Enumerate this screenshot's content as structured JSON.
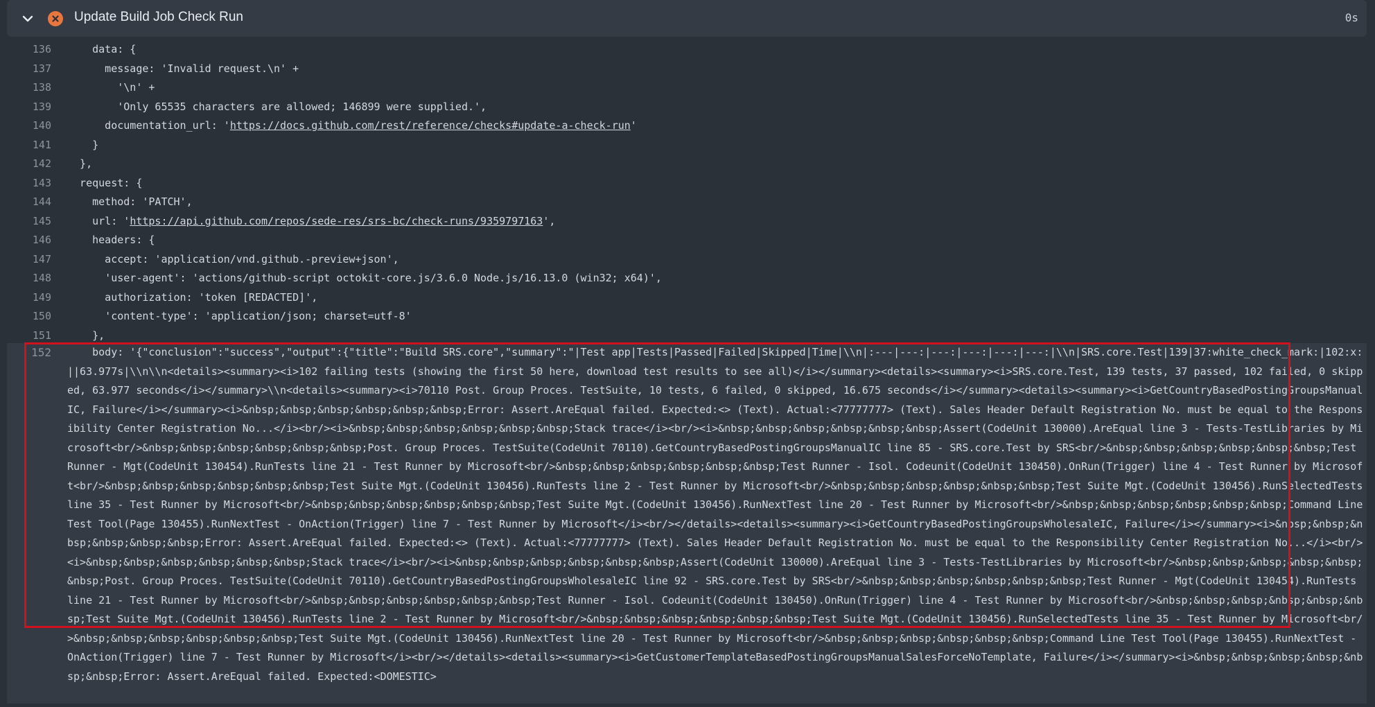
{
  "step": {
    "title": "Update Build Job Check Run",
    "duration": "0s"
  },
  "log_lines": [
    {
      "n": "136",
      "text": "    data: {"
    },
    {
      "n": "137",
      "text": "      message: 'Invalid request.\\n' +"
    },
    {
      "n": "138",
      "text": "        '\\n' +"
    },
    {
      "n": "139",
      "text": "        'Only 65535 characters are allowed; 146899 were supplied.',"
    },
    {
      "n": "140",
      "prefix": "      documentation_url: '",
      "link": "https://docs.github.com/rest/reference/checks#update-a-check-run",
      "suffix": "'"
    },
    {
      "n": "141",
      "text": "    }"
    },
    {
      "n": "142",
      "text": "  },"
    },
    {
      "n": "143",
      "text": "  request: {"
    },
    {
      "n": "144",
      "text": "    method: 'PATCH',"
    },
    {
      "n": "145",
      "prefix": "    url: '",
      "link": "https://api.github.com/repos/sede-res/srs-bc/check-runs/9359797163",
      "suffix": "',"
    },
    {
      "n": "146",
      "text": "    headers: {"
    },
    {
      "n": "147",
      "text": "      accept: 'application/vnd.github.-preview+json',"
    },
    {
      "n": "148",
      "text": "      'user-agent': 'actions/github-script octokit-core.js/3.6.0 Node.js/16.13.0 (win32; x64)',"
    },
    {
      "n": "149",
      "text": "      authorization: 'token [REDACTED]',"
    },
    {
      "n": "150",
      "text": "      'content-type': 'application/json; charset=utf-8'"
    },
    {
      "n": "151",
      "text": "    },"
    }
  ],
  "body_line": {
    "n": "152",
    "text": "    body: '{\"conclusion\":\"success\",\"output\":{\"title\":\"Build SRS.core\",\"summary\":\"|Test app|Tests|Passed|Failed|Skipped|Time|\\\\n|:---|---:|---:|---:|---:|---:|\\\\n|SRS.core.Test|139|37:white_check_mark:|102:x:||63.977s|\\\\n\\\\n<details><summary><i>102 failing tests (showing the first 50 here, download test results to see all)</i></summary><details><summary><i>SRS.core.Test, 139 tests, 37 passed, 102 failed, 0 skipped, 63.977 seconds</i></summary>\\\\n<details><summary><i>70110 Post. Group Proces. TestSuite, 10 tests, 6 failed, 0 skipped, 16.675 seconds</i></summary><details><summary><i>GetCountryBasedPostingGroupsManualIC, Failure</i></summary><i>&nbsp;&nbsp;&nbsp;&nbsp;&nbsp;&nbsp;Error: Assert.AreEqual failed. Expected:<> (Text). Actual:<77777777> (Text). Sales Header Default Registration No. must be equal to the Responsibility Center Registration No...</i><br/><i>&nbsp;&nbsp;&nbsp;&nbsp;&nbsp;&nbsp;Stack trace</i><br/><i>&nbsp;&nbsp;&nbsp;&nbsp;&nbsp;&nbsp;Assert(CodeUnit 130000).AreEqual line 3 - Tests-TestLibraries by Microsoft<br/>&nbsp;&nbsp;&nbsp;&nbsp;&nbsp;&nbsp;Post. Group Proces. TestSuite(CodeUnit 70110).GetCountryBasedPostingGroupsManualIC line 85 - SRS.core.Test by SRS<br/>&nbsp;&nbsp;&nbsp;&nbsp;&nbsp;&nbsp;Test Runner - Mgt(CodeUnit 130454).RunTests line 21 - Test Runner by Microsoft<br/>&nbsp;&nbsp;&nbsp;&nbsp;&nbsp;&nbsp;Test Runner - Isol. Codeunit(CodeUnit 130450).OnRun(Trigger) line 4 - Test Runner by Microsoft<br/>&nbsp;&nbsp;&nbsp;&nbsp;&nbsp;&nbsp;Test Suite Mgt.(CodeUnit 130456).RunTests line 2 - Test Runner by Microsoft<br/>&nbsp;&nbsp;&nbsp;&nbsp;&nbsp;&nbsp;Test Suite Mgt.(CodeUnit 130456).RunSelectedTests line 35 - Test Runner by Microsoft<br/>&nbsp;&nbsp;&nbsp;&nbsp;&nbsp;&nbsp;Test Suite Mgt.(CodeUnit 130456).RunNextTest line 20 - Test Runner by Microsoft<br/>&nbsp;&nbsp;&nbsp;&nbsp;&nbsp;&nbsp;Command Line Test Tool(Page 130455).RunNextTest - OnAction(Trigger) line 7 - Test Runner by Microsoft</i><br/></details><details><summary><i>GetCountryBasedPostingGroupsWholesaleIC, Failure</i></summary><i>&nbsp;&nbsp;&nbsp;&nbsp;&nbsp;&nbsp;Error: Assert.AreEqual failed. Expected:<> (Text). Actual:<77777777> (Text). Sales Header Default Registration No. must be equal to the Responsibility Center Registration No...</i><br/><i>&nbsp;&nbsp;&nbsp;&nbsp;&nbsp;&nbsp;Stack trace</i><br/><i>&nbsp;&nbsp;&nbsp;&nbsp;&nbsp;&nbsp;Assert(CodeUnit 130000).AreEqual line 3 - Tests-TestLibraries by Microsoft<br/>&nbsp;&nbsp;&nbsp;&nbsp;&nbsp;&nbsp;Post. Group Proces. TestSuite(CodeUnit 70110).GetCountryBasedPostingGroupsWholesaleIC line 92 - SRS.core.Test by SRS<br/>&nbsp;&nbsp;&nbsp;&nbsp;&nbsp;&nbsp;Test Runner - Mgt(CodeUnit 130454).RunTests line 21 - Test Runner by Microsoft<br/>&nbsp;&nbsp;&nbsp;&nbsp;&nbsp;&nbsp;Test Runner - Isol. Codeunit(CodeUnit 130450).OnRun(Trigger) line 4 - Test Runner by Microsoft<br/>&nbsp;&nbsp;&nbsp;&nbsp;&nbsp;&nbsp;Test Suite Mgt.(CodeUnit 130456).RunTests line 2 - Test Runner by Microsoft<br/>&nbsp;&nbsp;&nbsp;&nbsp;&nbsp;&nbsp;Test Suite Mgt.(CodeUnit 130456).RunSelectedTests line 35 - Test Runner by Microsoft<br/>&nbsp;&nbsp;&nbsp;&nbsp;&nbsp;&nbsp;Test Suite Mgt.(CodeUnit 130456).RunNextTest line 20 - Test Runner by Microsoft<br/>&nbsp;&nbsp;&nbsp;&nbsp;&nbsp;&nbsp;Command Line Test Tool(Page 130455).RunNextTest - OnAction(Trigger) line 7 - Test Runner by Microsoft</i><br/></details><details><summary><i>GetCustomerTemplateBasedPostingGroupsManualSalesForceNoTemplate, Failure</i></summary><i>&nbsp;&nbsp;&nbsp;&nbsp;&nbsp;&nbsp;Error: Assert.AreEqual failed. Expected:<DOMESTIC>"
  },
  "colors": {
    "background": "#2b3138",
    "header": "#343b44",
    "fail_icon": "#e8763f",
    "highlight_border": "#d0121f"
  }
}
